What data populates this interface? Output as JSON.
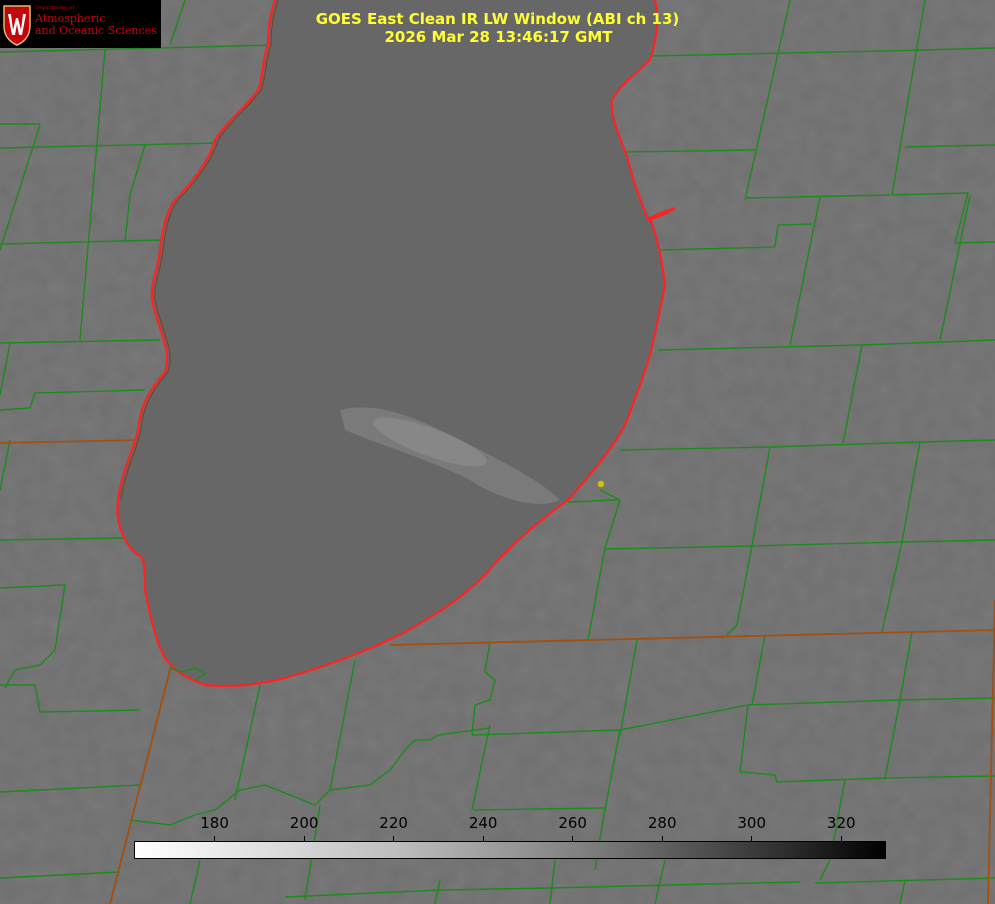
{
  "image": {
    "title_line1": "GOES East Clean IR LW Window (ABI ch 13)",
    "title_line2": "2026 Mar 28 13:46:17 GMT",
    "colors": {
      "background_gray": "#6f6f6f",
      "lake_gray": "#676767",
      "county_lines": "#1e8a1e",
      "coastline": "#ff2222",
      "state_lines": "#b05a10",
      "title_text": "#ffff33",
      "marker": "#d4c400"
    }
  },
  "logo": {
    "dept": "Department of",
    "line1": "Atmospheric",
    "line2": "and Oceanic Sciences",
    "brand_color": "#c5050c",
    "icon": "uw-crest-icon"
  },
  "colorbar": {
    "unit_scale": "brightness temperature",
    "min": 162,
    "max": 330,
    "gradient": "white-to-black",
    "tick_labels": [
      "180",
      "200",
      "220",
      "240",
      "260",
      "280",
      "300",
      "320"
    ],
    "tick_values": [
      180,
      200,
      220,
      240,
      260,
      280,
      300,
      320
    ]
  },
  "map": {
    "features": [
      "lake-outline",
      "county-boundaries",
      "state-boundaries",
      "location-marker"
    ]
  }
}
